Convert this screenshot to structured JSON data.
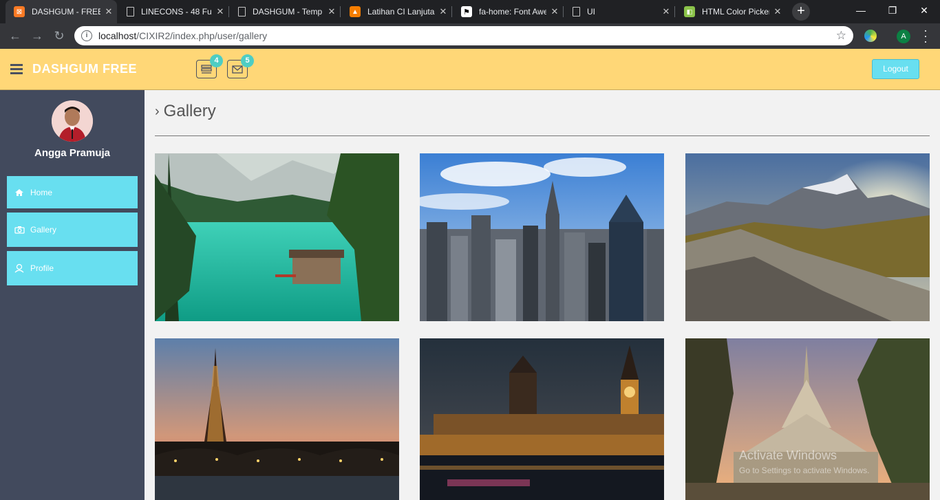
{
  "browser": {
    "tabs": [
      {
        "title": "DASHGUM - FREE",
        "icon": "xampp-icon",
        "active": true
      },
      {
        "title": "LINECONS - 48 Fu",
        "icon": "page-icon",
        "active": false
      },
      {
        "title": "DASHGUM - Temp",
        "icon": "page-icon",
        "active": false
      },
      {
        "title": "Latihan CI Lanjutan",
        "icon": "blogger-icon",
        "active": false
      },
      {
        "title": "fa-home: Font Awe",
        "icon": "flag-icon",
        "active": false
      },
      {
        "title": "UI",
        "icon": "page-icon",
        "active": false
      },
      {
        "title": "HTML Color Picker",
        "icon": "colorpicker-icon",
        "active": false
      }
    ],
    "url_host": "localhost",
    "url_path": "/CIXIR2/index.php/user/gallery",
    "account_initial": "A"
  },
  "header": {
    "brand": "DASHGUM FREE",
    "tasks_badge": "4",
    "mail_badge": "5",
    "logout_label": "Logout",
    "color": "#ffd777"
  },
  "sidebar": {
    "user_name": "Angga Pramuja",
    "items": [
      {
        "label": "Home",
        "icon": "home-icon"
      },
      {
        "label": "Gallery",
        "icon": "camera-icon"
      },
      {
        "label": "Profile",
        "icon": "user-icon"
      }
    ],
    "accent": "#68dff0"
  },
  "main": {
    "title": "Gallery",
    "images": [
      {
        "subject": "lake-forest"
      },
      {
        "subject": "city-skyline"
      },
      {
        "subject": "mountain-sunset"
      },
      {
        "subject": "eiffel-tower"
      },
      {
        "subject": "big-ben"
      },
      {
        "subject": "temple"
      }
    ]
  },
  "watermark": {
    "line1": "Activate Windows",
    "line2": "Go to Settings to activate Windows."
  }
}
